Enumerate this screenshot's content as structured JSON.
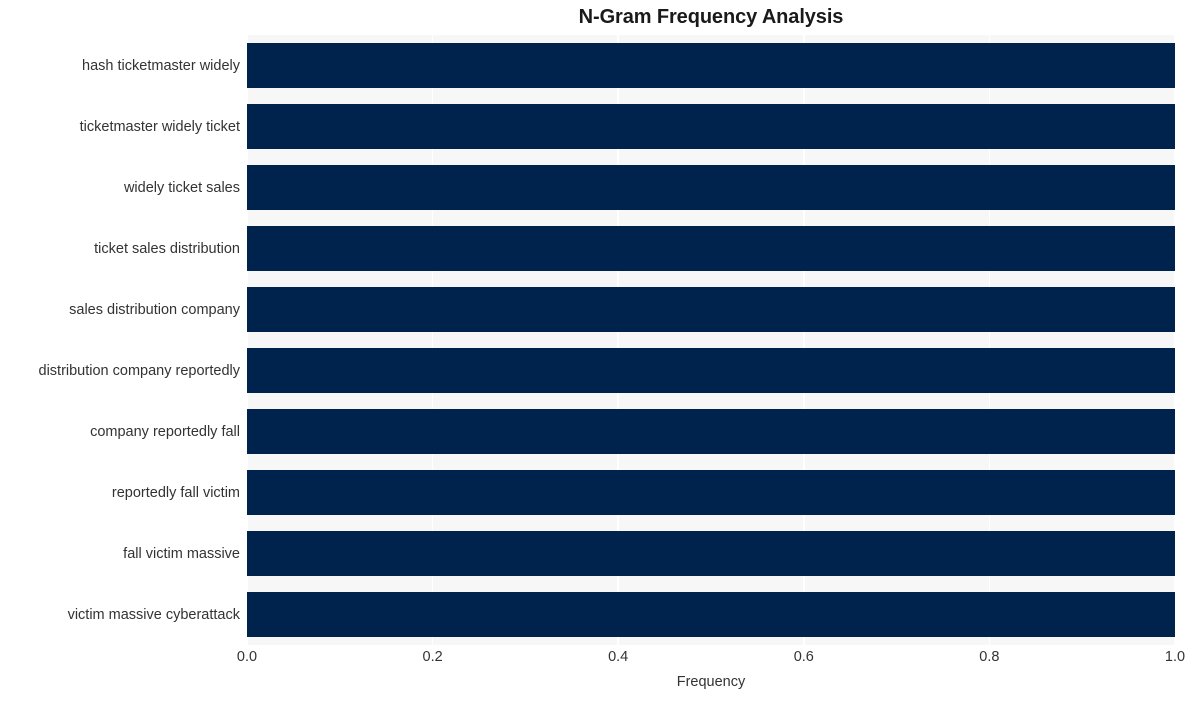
{
  "chart_data": {
    "type": "bar",
    "orientation": "horizontal",
    "title": "N-Gram Frequency Analysis",
    "xlabel": "Frequency",
    "ylabel": "",
    "xlim": [
      0.0,
      1.0
    ],
    "xticks": [
      "0.0",
      "0.2",
      "0.4",
      "0.6",
      "0.8",
      "1.0"
    ],
    "xtick_values": [
      0.0,
      0.2,
      0.4,
      0.6,
      0.8,
      1.0
    ],
    "grid": true,
    "grid_axis": "x",
    "legend": null,
    "bar_color": "#00234e",
    "plot_background": "#f7f7f7",
    "figure_background": "#ffffff",
    "categories": [
      "hash ticketmaster widely",
      "ticketmaster widely ticket",
      "widely ticket sales",
      "ticket sales distribution",
      "sales distribution company",
      "distribution company reportedly",
      "company reportedly fall",
      "reportedly fall victim",
      "fall victim massive",
      "victim massive cyberattack"
    ],
    "values": [
      1.0,
      1.0,
      1.0,
      1.0,
      1.0,
      1.0,
      1.0,
      1.0,
      1.0,
      1.0
    ]
  }
}
